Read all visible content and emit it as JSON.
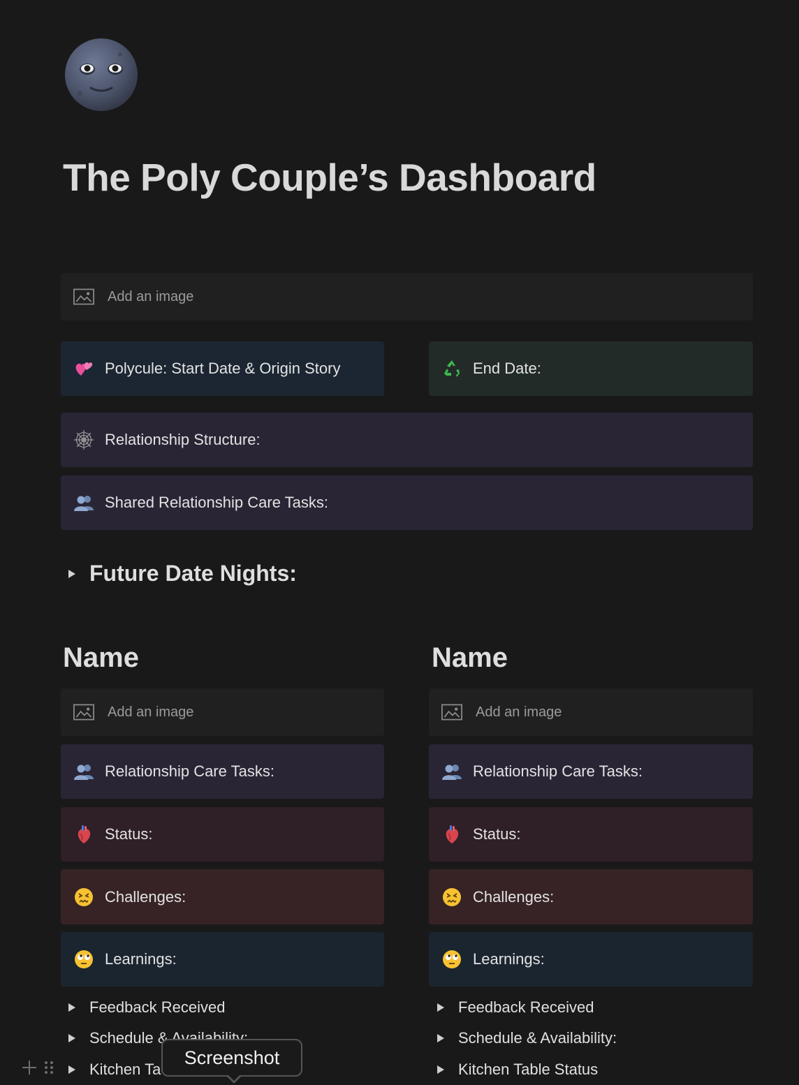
{
  "page": {
    "icon": "new-moon-face-icon",
    "title": "The Poly Couple’s Dashboard"
  },
  "top": {
    "image_placeholder": "Add an image",
    "start": {
      "icon": "two-hearts-icon",
      "label": "Polycule: Start Date & Origin Story"
    },
    "end": {
      "icon": "recycle-icon",
      "label": "End Date:"
    },
    "structure": {
      "icon": "spider-web-icon",
      "label": "Relationship Structure:"
    },
    "shared_tasks": {
      "icon": "busts-icon",
      "label": "Shared Relationship Care Tasks:"
    }
  },
  "future": {
    "label": "Future Date Nights:"
  },
  "columns": [
    {
      "name": "Name",
      "image_placeholder": "Add an image",
      "care_tasks": "Relationship Care Tasks:",
      "status": "Status:",
      "challenges": "Challenges:",
      "learnings": "Learnings:",
      "toggles": [
        "Feedback Received",
        "Schedule & Availability:",
        "Kitchen Ta"
      ]
    },
    {
      "name": "Name",
      "image_placeholder": "Add an image",
      "care_tasks": "Relationship Care Tasks:",
      "status": "Status:",
      "challenges": "Challenges:",
      "learnings": "Learnings:",
      "toggles": [
        "Feedback Received",
        "Schedule & Availability:",
        "Kitchen Table Status"
      ]
    }
  ],
  "icons": {
    "care_tasks": "busts-icon",
    "status": "anatomical-heart-icon",
    "challenges": "confounded-face-icon",
    "learnings": "face-with-rolling-eyes-icon"
  },
  "tooltip": {
    "text": "Screenshot"
  },
  "colors": {
    "background": "#191919",
    "blue_callout": "#1c2633",
    "green_callout": "#222b28",
    "purple_callout": "#2a2535",
    "red_callout": "#2f1f26",
    "brown_callout": "#372325"
  }
}
